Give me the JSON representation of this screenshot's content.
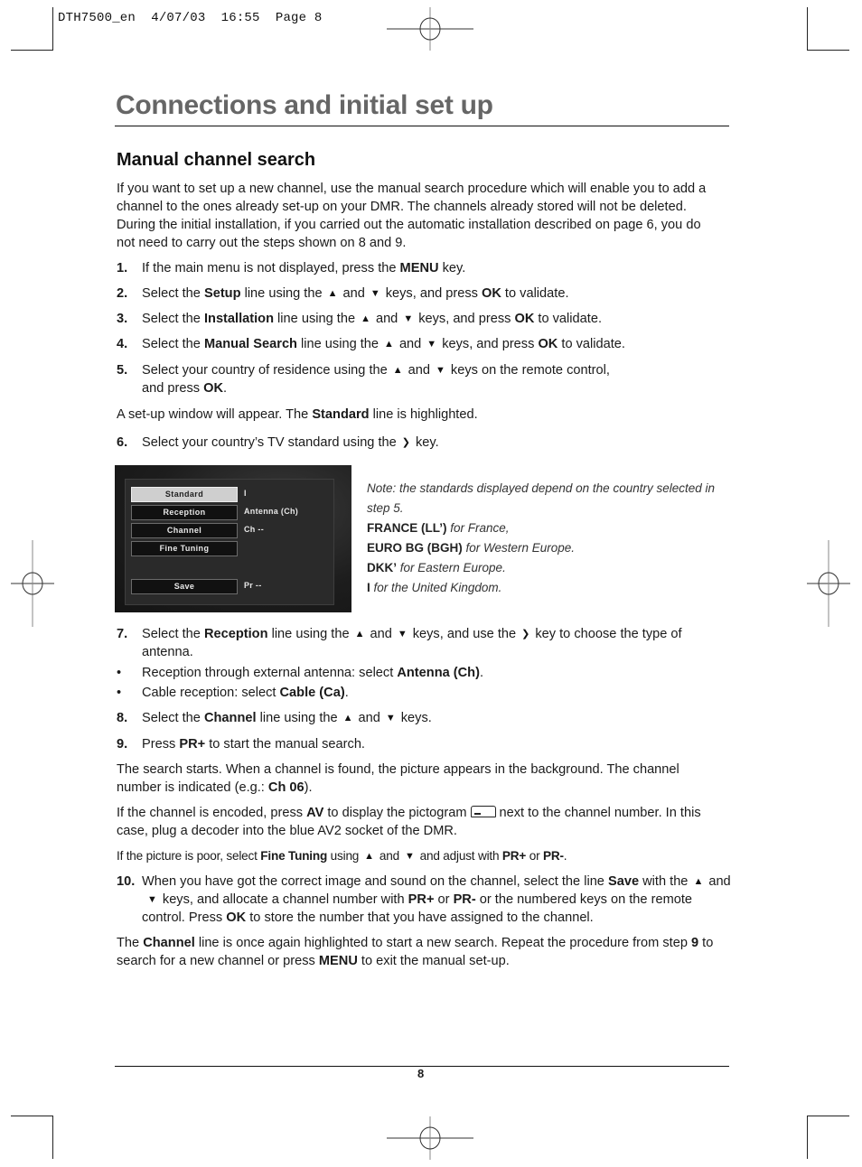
{
  "slug": "DTH7500_en  4/07/03  16:55  Page 8",
  "header": {
    "title": "Connections and initial set up"
  },
  "section": {
    "title": "Manual channel search"
  },
  "intro": "If you want to set up a new channel, use the manual search procedure which will enable you to add a channel to the ones already set-up on your DMR. The channels already stored will not be deleted. During the initial installation, if you carried out the automatic installation described on page 6, you do not need to carry out the steps shown on 8 and 9.",
  "steps": {
    "s1": {
      "num": "1.",
      "a": "If the main menu is not displayed, press the ",
      "b": "MENU",
      "c": " key."
    },
    "s2": {
      "num": "2.",
      "a": "Select the ",
      "b": "Setup",
      "c": " line using the",
      "d": "and",
      "e": "keys, and press ",
      "f": "OK",
      "g": " to validate."
    },
    "s3": {
      "num": "3.",
      "a": "Select the ",
      "b": "Installation",
      "c": " line using the",
      "d": "and",
      "e": "keys, and press ",
      "f": "OK",
      "g": " to validate."
    },
    "s4": {
      "num": "4.",
      "a": "Select the ",
      "b": "Manual Search",
      "c": " line using the",
      "d": "and",
      "e": "keys, and press ",
      "f": "OK",
      "g": " to validate."
    },
    "s5": {
      "num": "5.",
      "a": "Select your country of residence using the",
      "d": "and",
      "e": "keys on the remote control,",
      "f": "and press ",
      "g": "OK",
      "h": "."
    },
    "s6": {
      "num": "6.",
      "a": "Select your country’s TV standard using the",
      "c": "key."
    },
    "s7": {
      "num": "7.",
      "a": "Select the ",
      "b": "Reception",
      "c": " line using the",
      "d": "and",
      "e": "keys, and use the",
      "f": "key to choose the type of antenna."
    },
    "s8": {
      "num": "8.",
      "a": "Select the ",
      "b": "Channel",
      "c": " line using the",
      "d": "and",
      "e": "keys."
    },
    "s9": {
      "num": "9.",
      "a": "Press ",
      "b": "PR+",
      "c": " to start the manual search."
    },
    "s10": {
      "num": "10.",
      "a": "When you have got the correct image and sound on the channel, select the line ",
      "b": "Save",
      "c": " with the",
      "d": "and",
      "e": "keys, and allocate a channel number with ",
      "f": "PR+",
      "g": " or ",
      "h": "PR-",
      "i": " or the numbered keys on the remote control. Press ",
      "j": "OK",
      "k": " to store the number that you have assigned to the channel."
    }
  },
  "setup_window": {
    "a": "A set-up window will appear. The ",
    "b": "Standard",
    "c": " line is highlighted."
  },
  "tv_menu": {
    "rows": [
      {
        "label": "Standard",
        "value": "I",
        "selected": true
      },
      {
        "label": "Reception",
        "value": "Antenna (Ch)"
      },
      {
        "label": "Channel",
        "value": "Ch --"
      },
      {
        "label": "Fine Tuning",
        "value": ""
      },
      {
        "label": "Save",
        "value": "Pr --"
      }
    ]
  },
  "note": {
    "intro": "Note: the standards displayed depend on the country selected in step 5.",
    "items": [
      {
        "std": "FRANCE (LL’)",
        "desc": " for France,"
      },
      {
        "std": "EURO BG (BGH)",
        "desc": " for Western Europe."
      },
      {
        "std": "DKK’",
        "desc": " for Eastern Europe."
      },
      {
        "std": "I",
        "desc": " for the United Kingdom."
      }
    ]
  },
  "bullets": [
    {
      "a": "Reception through external antenna: select ",
      "b": "Antenna (Ch)",
      "c": "."
    },
    {
      "a": "Cable reception: select ",
      "b": "Cable (Ca)",
      "c": "."
    }
  ],
  "search_starts": {
    "a": "The search starts. When a channel is found, the picture appears in the background. The channel number is indicated (e.g.: ",
    "b": "Ch 06",
    "c": ")."
  },
  "encoded": {
    "a": "If the channel is encoded, press ",
    "b": "AV",
    "c": " to display the pictogram",
    "d": "next to the channel number. In this case, plug a decoder into the blue AV2 socket of the DMR."
  },
  "poor": {
    "a": "If the picture is poor, select ",
    "b": "Fine Tuning",
    "c": " using",
    "d": "and",
    "e": "and adjust with ",
    "f": "PR+",
    "g": " or ",
    "h": "PR-",
    "i": "."
  },
  "closing": {
    "a": "The ",
    "b": "Channel",
    "c": " line is once again highlighted to start a new search. Repeat the procedure from step ",
    "d": "9",
    "e": " to search for a new channel or press ",
    "f": "MENU",
    "g": " to exit the manual set-up."
  },
  "icons": {
    "up": "▲",
    "down": "▼",
    "right": "❯",
    "bullet": "•"
  },
  "footer": {
    "page_number": "8"
  }
}
